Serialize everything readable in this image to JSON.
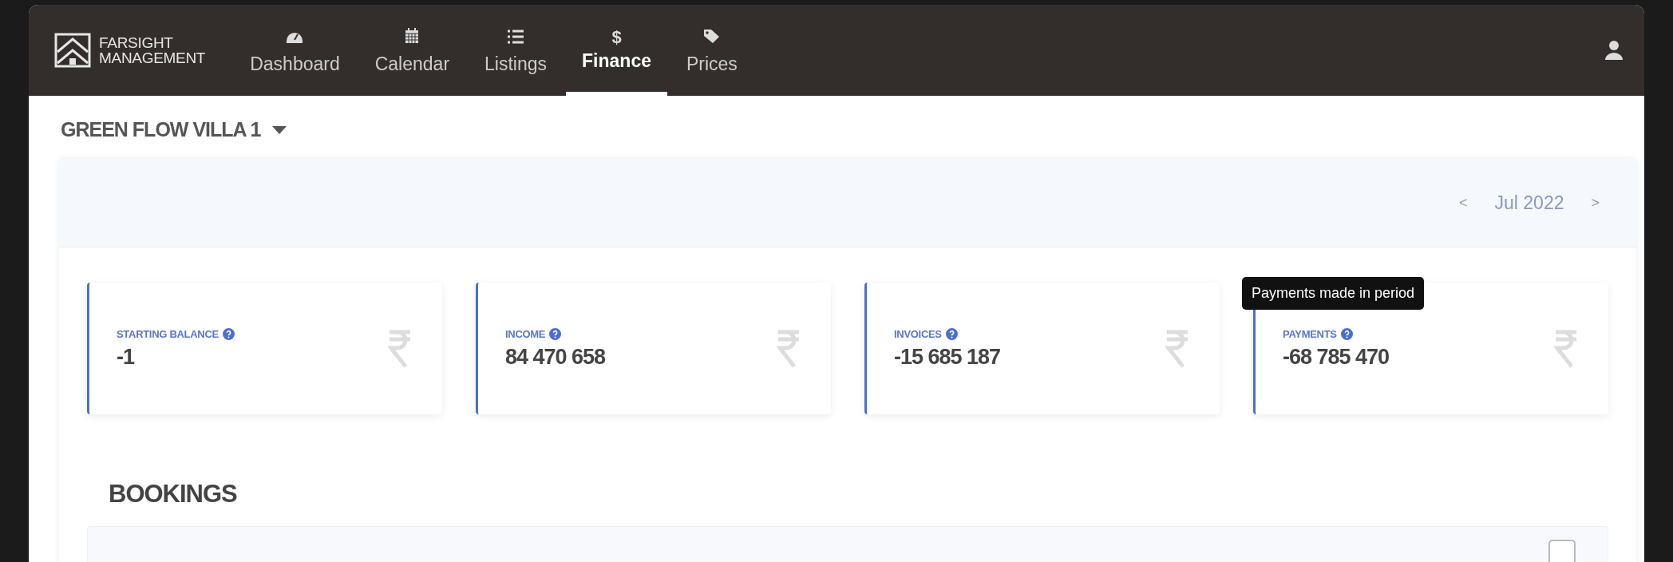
{
  "brand": {
    "line_1": "FARSIGHT",
    "line_2": "MANAGEMENT"
  },
  "nav": [
    {
      "label": "Dashboard",
      "kind": "gauge",
      "selected": false
    },
    {
      "label": "Calendar",
      "kind": "calendar",
      "selected": false
    },
    {
      "label": "Listings",
      "kind": "list",
      "selected": false
    },
    {
      "label": "Finance",
      "kind": "symbol",
      "symbol": "$",
      "selected": true
    },
    {
      "label": "Prices",
      "kind": "tags",
      "selected": false
    }
  ],
  "property": {
    "title": "GREEN FLOW VILLA 1"
  },
  "period": {
    "prev": "<",
    "month": "Jul 2022",
    "next": ">"
  },
  "stats": [
    {
      "label": "STARTING BALANCE",
      "value": "-1"
    },
    {
      "label": "INCOME",
      "value": "84 470 658"
    },
    {
      "label": "INVOICES",
      "value": "-15 685 187"
    },
    {
      "label": "PAYMENTS",
      "value": "-68 785 470",
      "tooltip": "Payments made in period"
    }
  ],
  "bookings": {
    "title": "BOOKINGS",
    "select_all": {
      "checked": false
    }
  }
}
